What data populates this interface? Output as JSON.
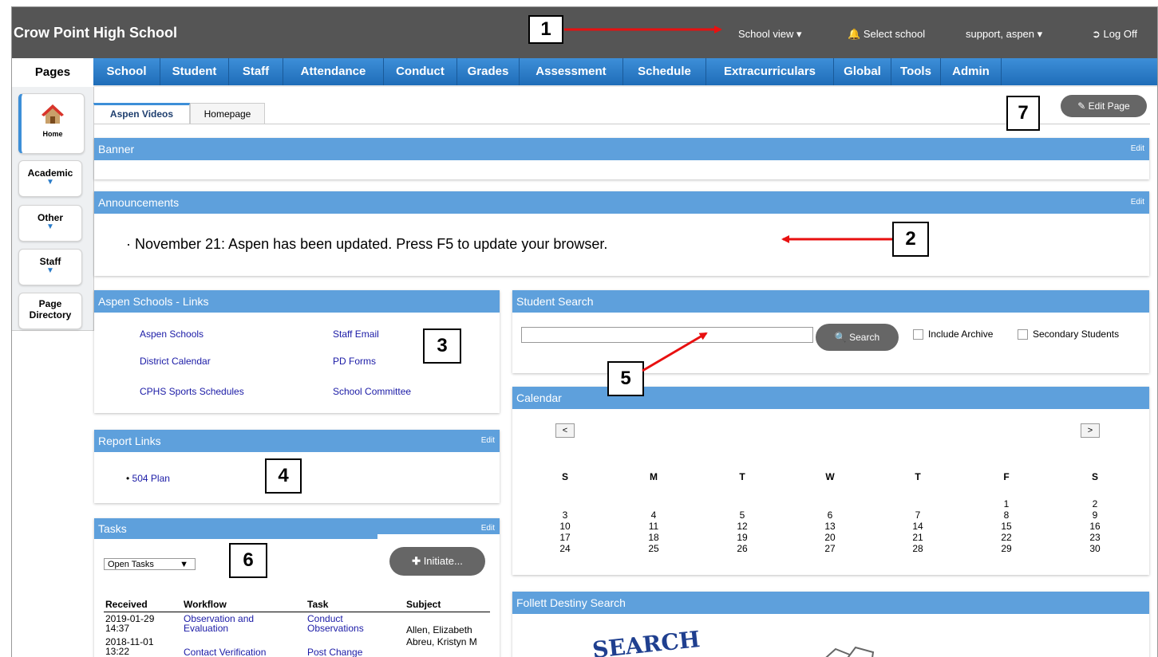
{
  "header": {
    "school_name": "Crow Point High School",
    "school_view": "School view ▾",
    "select_school": "Select school",
    "user": "support, aspen ▾",
    "logoff": "Log Off"
  },
  "nav": {
    "pages": "Pages",
    "menu": [
      "School",
      "Student",
      "Staff",
      "Attendance",
      "Conduct",
      "Grades",
      "Assessment",
      "Schedule",
      "Extracurriculars",
      "Global",
      "Tools",
      "Admin"
    ]
  },
  "sidebar": {
    "items": [
      {
        "label": "Home"
      },
      {
        "label": "Academic"
      },
      {
        "label": "Other"
      },
      {
        "label": "Staff"
      },
      {
        "label": "Page Directory"
      }
    ]
  },
  "tabs": [
    "Aspen Videos",
    "Homepage"
  ],
  "edit_page": "Edit Page",
  "panels": {
    "banner": {
      "title": "Banner",
      "edit": "Edit"
    },
    "announcements": {
      "title": "Announcements",
      "edit": "Edit",
      "text": "November 21: Aspen has been updated. Press F5 to update your browser."
    },
    "links": {
      "title": "Aspen Schools - Links",
      "left": [
        "Aspen Schools",
        "District Calendar",
        "CPHS Sports Schedules"
      ],
      "right": [
        "Staff Email",
        "PD Forms",
        "School Committee"
      ]
    },
    "report_links": {
      "title": "Report Links",
      "edit": "Edit",
      "items": [
        "504 Plan"
      ]
    },
    "tasks": {
      "title": "Tasks",
      "edit": "Edit",
      "filter": "Open Tasks",
      "initiate": "Initiate...",
      "columns": [
        "Received",
        "Workflow",
        "Task",
        "Subject"
      ],
      "rows": [
        {
          "received": "2019-01-29 14:37",
          "workflow": "Observation and Evaluation",
          "task": "Conduct Observations",
          "subject": "Allen, Elizabeth"
        },
        {
          "received": "2018-11-01 13:22",
          "workflow": "Contact Verification",
          "task": "Post Change",
          "subject": "Abreu, Kristyn M"
        }
      ]
    },
    "student_search": {
      "title": "Student Search",
      "button": "Search",
      "include_archive": "Include Archive",
      "secondary": "Secondary Students",
      "query": ""
    },
    "calendar": {
      "title": "Calendar",
      "prev": "<",
      "next": ">",
      "days": [
        "S",
        "M",
        "T",
        "W",
        "T",
        "F",
        "S"
      ],
      "weeks": [
        [
          "",
          "",
          "",
          "",
          "",
          "1",
          "2"
        ],
        [
          "3",
          "4",
          "5",
          "6",
          "7",
          "8",
          "9"
        ],
        [
          "10",
          "11",
          "12",
          "13",
          "14",
          "15",
          "16"
        ],
        [
          "17",
          "18",
          "19",
          "20",
          "21",
          "22",
          "23"
        ],
        [
          "24",
          "25",
          "26",
          "27",
          "28",
          "29",
          "30"
        ]
      ]
    },
    "destiny": {
      "title": "Follett Destiny Search",
      "logo_text": "SEARCH"
    }
  },
  "annotations": [
    "1",
    "2",
    "3",
    "4",
    "5",
    "6",
    "7"
  ],
  "colors": {
    "header": "#555555",
    "menu": "#2a7bc8",
    "panel_head": "#5ea0dc",
    "arrow": "#e81010",
    "link": "#1a1aa6"
  }
}
